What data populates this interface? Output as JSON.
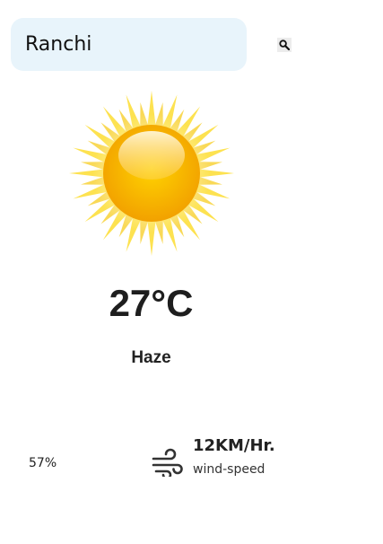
{
  "search": {
    "value": "Ranchi",
    "button_icon": "magnifier-icon"
  },
  "weather": {
    "icon": "sun-icon",
    "temperature": "27°C",
    "condition": "Haze"
  },
  "details": {
    "humidity_value": "57%",
    "wind_icon": "wind-icon",
    "wind_value": "12KM/Hr.",
    "wind_label": "wind-speed"
  },
  "colors": {
    "search_background": "#e8f4fb",
    "sun_core": "#f7b500",
    "sun_rays": "#fde047",
    "text": "#222222"
  }
}
